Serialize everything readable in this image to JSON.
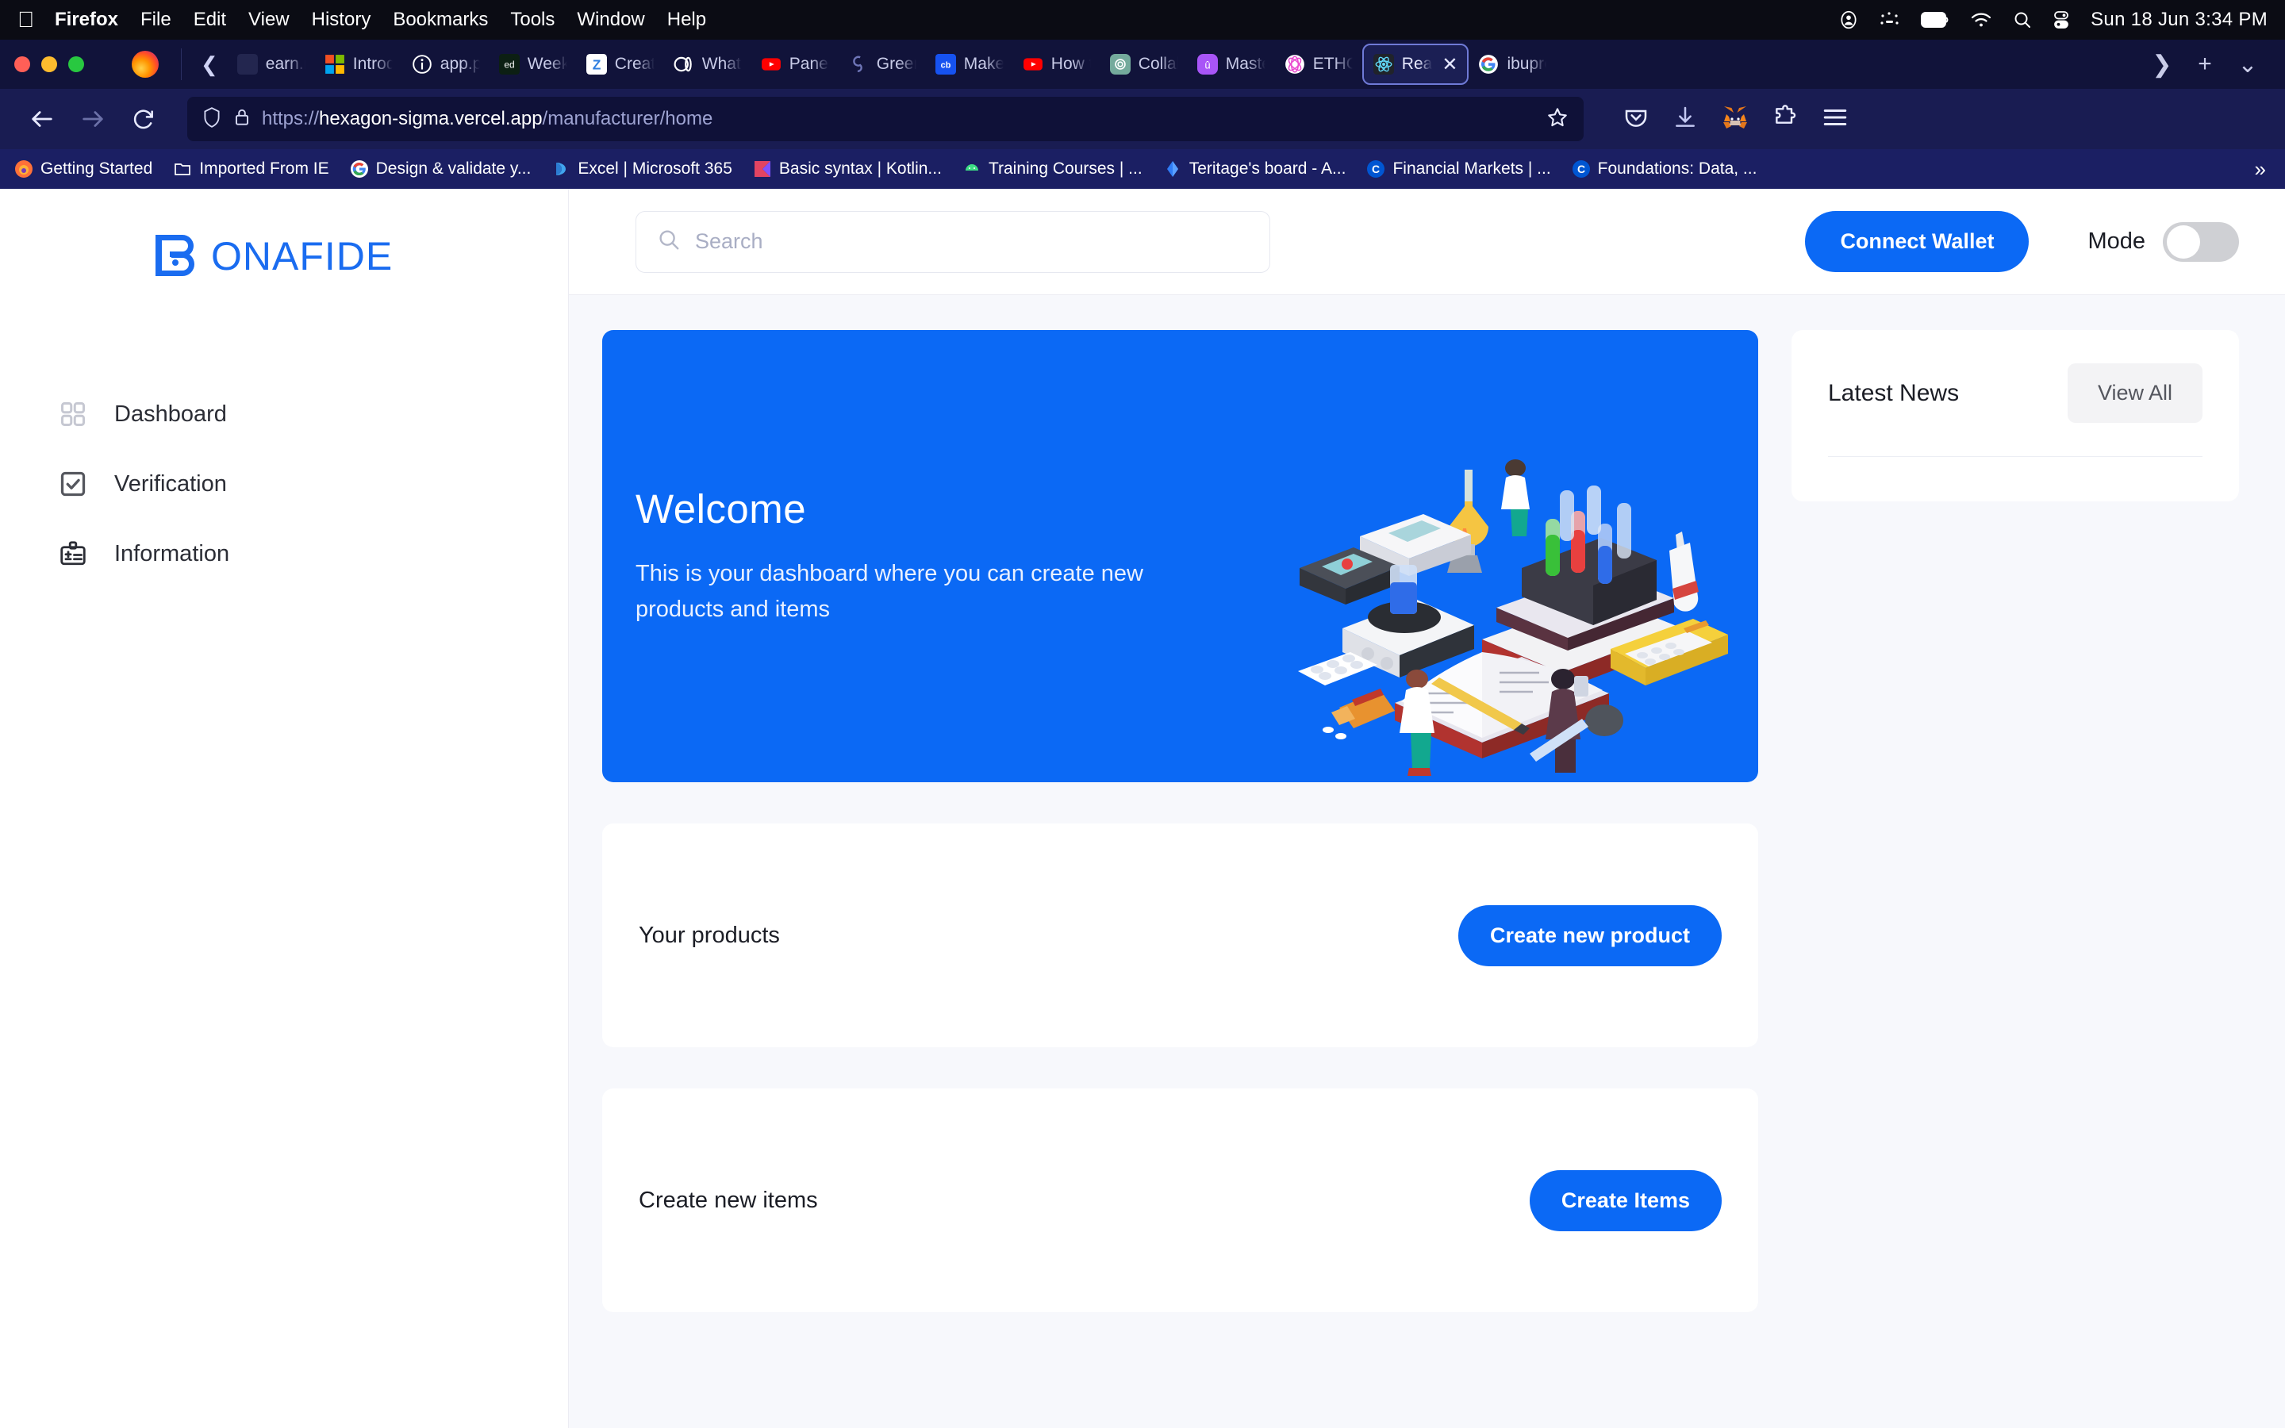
{
  "os_menubar": {
    "apple_icon": "apple-logo-icon",
    "items": [
      "Firefox",
      "File",
      "Edit",
      "View",
      "History",
      "Bookmarks",
      "Tools",
      "Window",
      "Help"
    ],
    "status_icons": [
      "user-account-icon",
      "control-strip-icon",
      "battery-icon",
      "wifi-icon",
      "spotlight-search-icon",
      "control-center-icon"
    ],
    "clock": "Sun 18 Jun  3:34 PM"
  },
  "browser": {
    "window_controls": [
      "close",
      "minimize",
      "maximize"
    ],
    "app_icon": "firefox-icon",
    "tab_scroll_left_icon": "chevron-left-icon",
    "tabs": [
      {
        "label": "earn.m",
        "favicon": "generic-icon",
        "active": false
      },
      {
        "label": "Introdu",
        "favicon": "microsoft-icon",
        "active": false
      },
      {
        "label": "app.po",
        "favicon": "info-circle-icon",
        "active": false
      },
      {
        "label": "Week",
        "favicon": "edx-icon",
        "active": false
      },
      {
        "label": "Creati",
        "favicon": "zoho-icon",
        "active": false
      },
      {
        "label": "What i",
        "favicon": "medium-icon",
        "active": false
      },
      {
        "label": "Panel:",
        "favicon": "youtube-icon",
        "active": false
      },
      {
        "label": "Green",
        "favicon": "gitcoin-icon",
        "active": false
      },
      {
        "label": "Maker",
        "favicon": "cb-icon",
        "active": false
      },
      {
        "label": "How to",
        "favicon": "youtube-icon",
        "active": false
      },
      {
        "label": "Collab",
        "favicon": "openai-icon",
        "active": false
      },
      {
        "label": "Master",
        "favicon": "unstoppable-icon",
        "active": false
      },
      {
        "label": "ETHGl",
        "favicon": "ethglobal-icon",
        "active": false
      },
      {
        "label": "Rea",
        "favicon": "react-icon",
        "active": true,
        "close_icon": "close-icon"
      },
      {
        "label": "ibupro",
        "favicon": "google-icon",
        "active": false
      }
    ],
    "tabstrip_buttons": [
      "list-all-tabs-chevron-icon",
      "new-tab-plus-icon",
      "tab-overview-chevron-down-icon"
    ],
    "nav": {
      "back_icon": "arrow-left-icon",
      "forward_icon": "arrow-right-icon",
      "reload_icon": "reload-icon",
      "shield_icon": "shield-icon",
      "lock_icon": "padlock-icon",
      "url_scheme": "https://",
      "url_host": "hexagon-sigma.vercel.app",
      "url_path": "/manufacturer/home",
      "bookmark_star_icon": "star-icon"
    },
    "toolbar_right": [
      "pocket-icon",
      "downloads-icon",
      "metamask-icon",
      "extensions-puzzle-icon",
      "hamburger-menu-icon"
    ],
    "bookmarks": [
      {
        "label": "Getting Started",
        "icon": "firefox-icon"
      },
      {
        "label": "Imported From IE",
        "icon": "folder-icon"
      },
      {
        "label": "Design & validate y...",
        "icon": "google-icon"
      },
      {
        "label": "Excel | Microsoft 365",
        "icon": "excel-icon"
      },
      {
        "label": "Basic syntax | Kotlin...",
        "icon": "kotlin-icon"
      },
      {
        "label": "Training Courses  |  ...",
        "icon": "android-icon"
      },
      {
        "label": "Teritage's board - A...",
        "icon": "diamond-icon"
      },
      {
        "label": "Financial Markets | ...",
        "icon": "coursera-icon"
      },
      {
        "label": "Foundations: Data, ...",
        "icon": "coursera-icon"
      }
    ],
    "bookmarks_overflow_icon": "double-chevron-right-icon"
  },
  "app": {
    "brand": {
      "name": "BONAFIDE",
      "logo_icon": "bonafide-b-logo-icon"
    },
    "sidebar": {
      "items": [
        {
          "label": "Dashboard",
          "icon": "grid-dashboard-icon"
        },
        {
          "label": "Verification",
          "icon": "checkbox-check-icon"
        },
        {
          "label": "Information",
          "icon": "id-badge-icon"
        }
      ]
    },
    "header": {
      "search": {
        "placeholder": "Search",
        "value": "",
        "icon": "search-icon"
      },
      "connect_wallet_label": "Connect Wallet",
      "mode_label": "Mode",
      "mode_on": false
    },
    "hero": {
      "title": "Welcome",
      "subtitle": "This is your dashboard where you can create new products and items",
      "illustration": "laboratory-pharma-isometric-illustration",
      "background_color": "#0b69f5"
    },
    "news": {
      "title": "Latest News",
      "view_all_label": "View All"
    },
    "panels": [
      {
        "title": "Your products",
        "button_label": "Create new product"
      },
      {
        "title": "Create new items",
        "button_label": "Create Items"
      }
    ],
    "colors": {
      "accent": "#0b69f5",
      "page_bg": "#f7f8fc",
      "card_bg": "#ffffff",
      "text": "#1b1d25"
    }
  }
}
